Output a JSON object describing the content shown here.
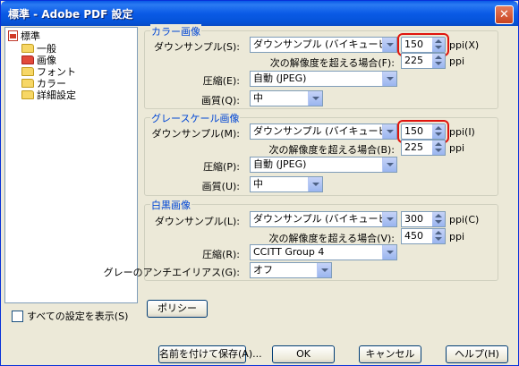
{
  "window": {
    "title": "標準 - Adobe PDF 設定",
    "close_glyph": "✕"
  },
  "tree": {
    "root": "標準",
    "items": [
      "一般",
      "画像",
      "フォント",
      "カラー",
      "詳細設定"
    ]
  },
  "show_all": "すべての設定を表示(S)",
  "color": {
    "title": "カラー画像",
    "downsample_label": "ダウンサンプル(S):",
    "downsample_value": "ダウンサンプル (バイキュービック法)",
    "ppi_value": "150",
    "ppi_unit": "ppi(X)",
    "threshold_label": "次の解像度を超える場合(F):",
    "threshold_value": "225",
    "threshold_unit": "ppi",
    "compress_label": "圧縮(E):",
    "compress_value": "自動 (JPEG)",
    "quality_label": "画質(Q):",
    "quality_value": "中"
  },
  "gray": {
    "title": "グレースケール画像",
    "downsample_label": "ダウンサンプル(M):",
    "downsample_value": "ダウンサンプル (バイキュービック法)",
    "ppi_value": "150",
    "ppi_unit": "ppi(I)",
    "threshold_label": "次の解像度を超える場合(B):",
    "threshold_value": "225",
    "threshold_unit": "ppi",
    "compress_label": "圧縮(P):",
    "compress_value": "自動 (JPEG)",
    "quality_label": "画質(U):",
    "quality_value": "中"
  },
  "mono": {
    "title": "白黒画像",
    "downsample_label": "ダウンサンプル(L):",
    "downsample_value": "ダウンサンプル (バイキュービック法)",
    "ppi_value": "300",
    "ppi_unit": "ppi(C)",
    "threshold_label": "次の解像度を超える場合(V):",
    "threshold_value": "450",
    "threshold_unit": "ppi",
    "compress_label": "圧縮(R):",
    "compress_value": "CCITT Group 4",
    "antialias_label": "グレーのアンチエイリアス(G):",
    "antialias_value": "オフ"
  },
  "buttons": {
    "policy": "ポリシー",
    "save_as": "名前を付けて保存(A)...",
    "ok": "OK",
    "cancel": "キャンセル",
    "help": "ヘルプ(H)"
  },
  "colors": {
    "accent": "#0046d5",
    "highlight": "#e0140d",
    "titlebar": "#0a5ae6"
  }
}
